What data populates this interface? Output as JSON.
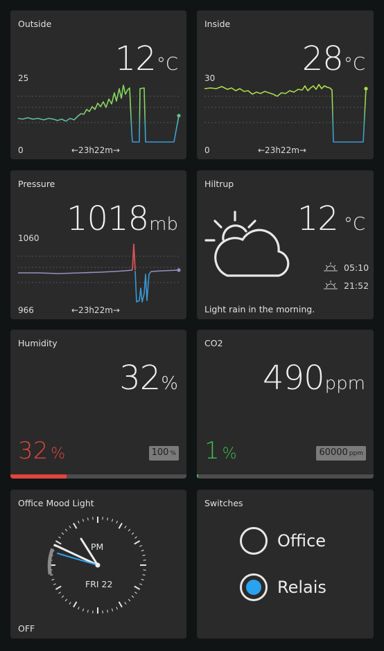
{
  "outside": {
    "title": "Outside",
    "value": "12",
    "unit": "°C",
    "ymax": "25",
    "ymin": "0",
    "span": "←23h22m→"
  },
  "inside": {
    "title": "Inside",
    "value": "28",
    "unit": "°C",
    "ymax": "30",
    "ymin": "0",
    "span": "←23h22m→"
  },
  "pressure": {
    "title": "Pressure",
    "value": "1018",
    "unit": "mb",
    "ymax": "1060",
    "ymin": "966",
    "span": "←23h22m→"
  },
  "weather": {
    "title": "Hiltrup",
    "value": "12",
    "unit": "°C",
    "sunrise": "05:10",
    "sunset": "21:52",
    "forecast": "Light rain in the morning.",
    "icon": "partly-cloudy-day-icon"
  },
  "humidity": {
    "title": "Humidity",
    "value": "32",
    "unit": "%",
    "level": "32",
    "level_unit": "%",
    "max": "100",
    "max_unit": "%",
    "fraction": 0.32,
    "color": "#e0453d"
  },
  "co2": {
    "title": "CO2",
    "value": "490",
    "unit": "ppm",
    "level": "1",
    "level_unit": "%",
    "max": "60000",
    "max_unit": "ppm",
    "fraction": 0.008,
    "color": "#3fbf4a"
  },
  "mood_light": {
    "title": "Office Mood Light",
    "ampm": "PM",
    "day": "FRI 22",
    "status": "OFF"
  },
  "switches": {
    "title": "Switches",
    "items": [
      {
        "label": "Office",
        "on": false
      },
      {
        "label": "Relais",
        "on": true
      }
    ]
  },
  "colors": {
    "accent": "#2aa3ef",
    "green": "#7ed957",
    "red": "#e0453d"
  }
}
